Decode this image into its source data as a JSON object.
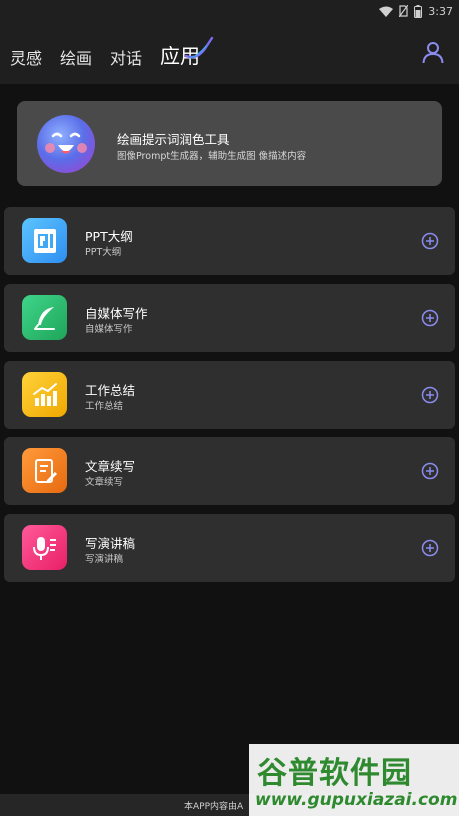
{
  "status_bar": {
    "time": "3:37"
  },
  "header": {
    "tabs": [
      {
        "label": "灵感"
      },
      {
        "label": "绘画"
      },
      {
        "label": "对话"
      },
      {
        "label": "应用"
      }
    ],
    "active_tab": "应用",
    "user_icon": "user-icon"
  },
  "feature": {
    "title": "绘画提示词润色工具",
    "subtitle": "图像Prompt生成器，辅助生成图 像描述内容",
    "icon": "smiling-face-avatar"
  },
  "apps": [
    {
      "title": "PPT大纲",
      "subtitle": "PPT大纲",
      "icon": "ppt-icon",
      "color": "#3fa9f5"
    },
    {
      "title": "自媒体写作",
      "subtitle": "自媒体写作",
      "icon": "feather-pen-icon",
      "color": "#2ebd6e"
    },
    {
      "title": "工作总结",
      "subtitle": "工作总结",
      "icon": "bar-chart-icon",
      "color": "#f5b800"
    },
    {
      "title": "文章续写",
      "subtitle": "文章续写",
      "icon": "document-edit-icon",
      "color": "#f07a1a"
    },
    {
      "title": "写演讲稿",
      "subtitle": "写演讲稿",
      "icon": "microphone-icon",
      "color": "#f0327d"
    }
  ],
  "footer": {
    "text": "本APP内容由A"
  },
  "watermark": {
    "title": "谷普软件园",
    "url": "www.gupuxiazai.com"
  },
  "colors": {
    "accent": "#7b6cf6",
    "card": "#2f2f2f",
    "background": "#111111"
  }
}
